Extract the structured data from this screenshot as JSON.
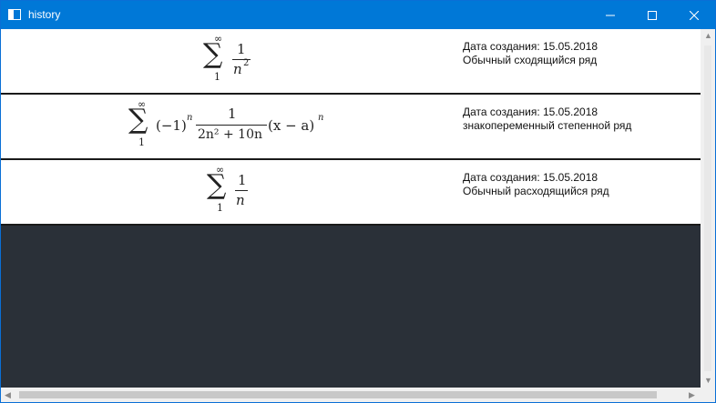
{
  "window": {
    "title": "history"
  },
  "rows": [
    {
      "formula": {
        "sum_top": "∞",
        "sum_bottom": "1",
        "numerator": "1",
        "denominator": "n",
        "denominator_exp": "2"
      },
      "date": "Дата создания: 15.05.2018",
      "description": "Обычный сходящийся ряд"
    },
    {
      "formula": {
        "sum_top": "∞",
        "sum_bottom": "1",
        "prefix": "(−1)",
        "prefix_exp": "n",
        "numerator": "1",
        "denominator": "2n² + 10n",
        "suffix": "(x − a)",
        "suffix_exp": "n"
      },
      "date": "Дата создания: 15.05.2018",
      "description": "знакопеременный степенной ряд"
    },
    {
      "formula": {
        "sum_top": "∞",
        "sum_bottom": "1",
        "numerator": "1",
        "denominator": "n"
      },
      "date": "Дата создания: 15.05.2018",
      "description": "Обычный расходящийся ряд"
    }
  ],
  "icons": {
    "app": "window-icon",
    "minimize": "minimize-icon",
    "maximize": "maximize-icon",
    "close": "close-icon"
  },
  "colors": {
    "titlebar": "#0078d7",
    "empty_area": "#2a3038",
    "row_separator": "#1a1a1a"
  }
}
